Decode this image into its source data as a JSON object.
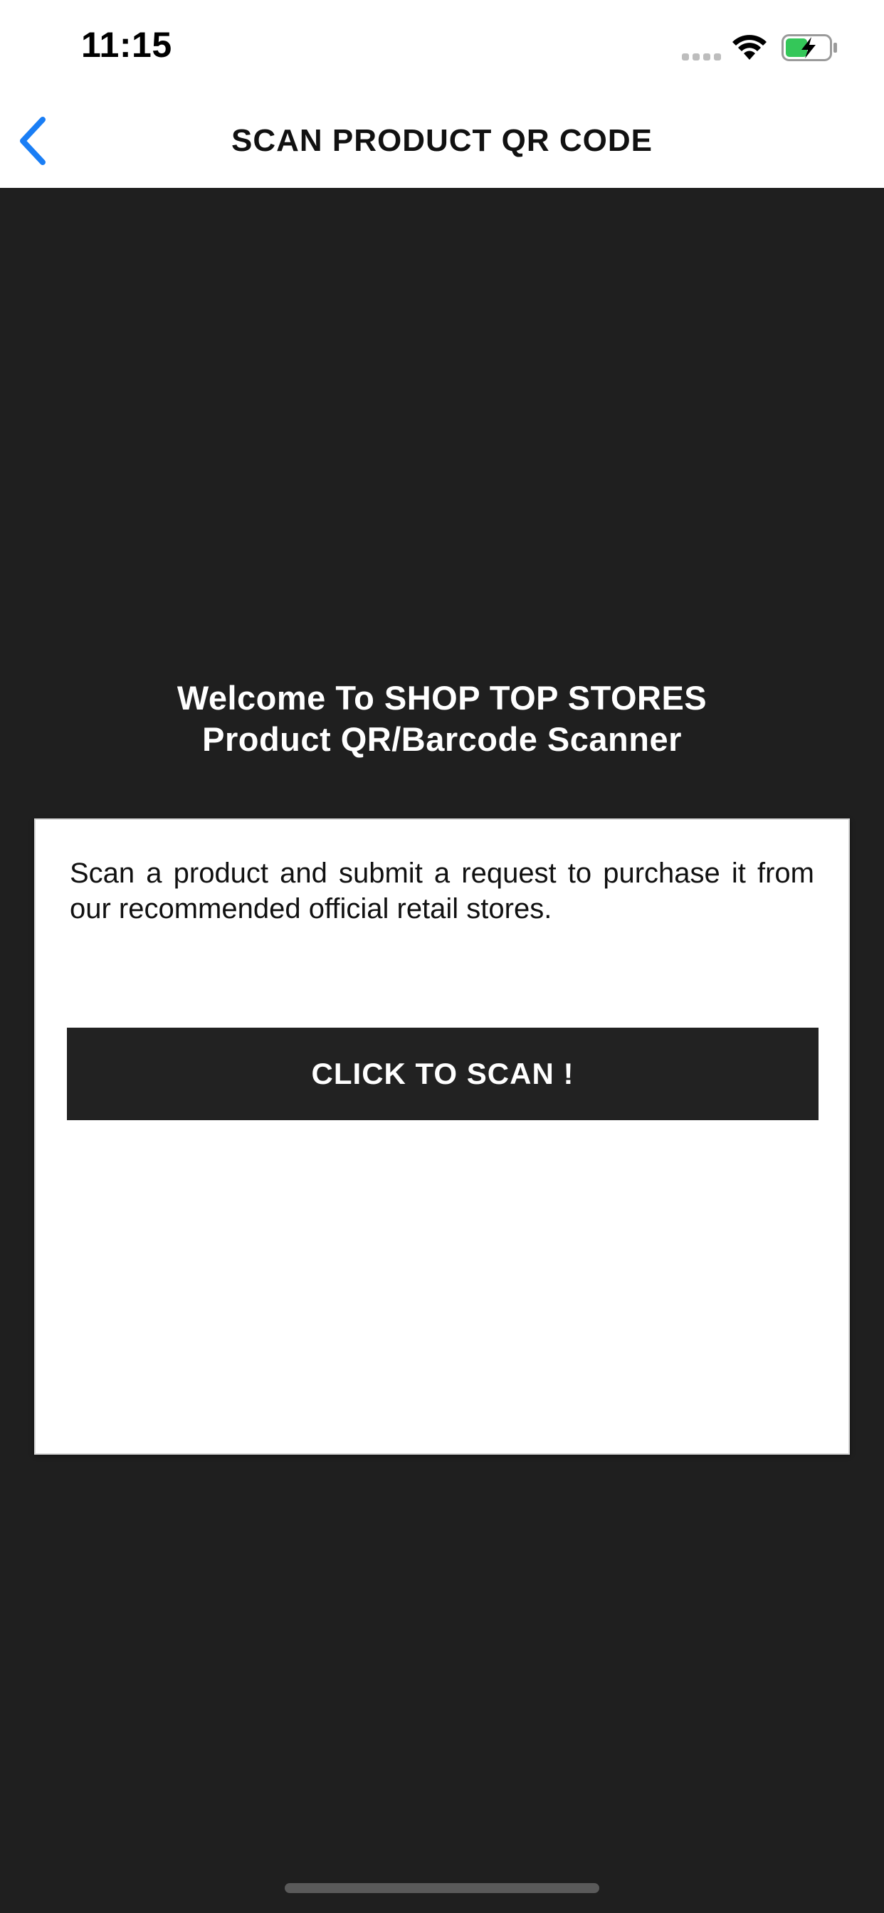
{
  "status_bar": {
    "time": "11:15",
    "icons": [
      "signal-dots-icon",
      "wifi-icon",
      "battery-charging-icon"
    ],
    "battery_color": "#34c759"
  },
  "nav": {
    "back_icon": "chevron-left-icon",
    "title": "SCAN PRODUCT QR CODE",
    "accent_color": "#007aff"
  },
  "main": {
    "welcome_line1": "Welcome To SHOP TOP STORES",
    "welcome_line2": "Product QR/Barcode Scanner",
    "card": {
      "description": "Scan a product and submit a request to purchase it from our recommended official retail stores.",
      "scan_button_label": "CLICK TO SCAN !"
    }
  }
}
